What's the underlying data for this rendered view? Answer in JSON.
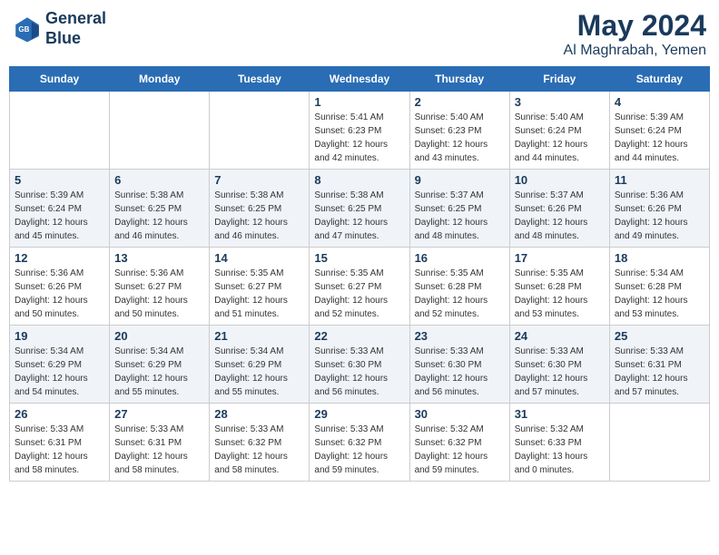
{
  "header": {
    "logo_line1": "General",
    "logo_line2": "Blue",
    "title": "May 2024",
    "subtitle": "Al Maghrabah, Yemen"
  },
  "days_of_week": [
    "Sunday",
    "Monday",
    "Tuesday",
    "Wednesday",
    "Thursday",
    "Friday",
    "Saturday"
  ],
  "weeks": [
    [
      {
        "day": "",
        "sunrise": "",
        "sunset": "",
        "daylight": ""
      },
      {
        "day": "",
        "sunrise": "",
        "sunset": "",
        "daylight": ""
      },
      {
        "day": "",
        "sunrise": "",
        "sunset": "",
        "daylight": ""
      },
      {
        "day": "1",
        "sunrise": "5:41 AM",
        "sunset": "6:23 PM",
        "daylight": "12 hours and 42 minutes."
      },
      {
        "day": "2",
        "sunrise": "5:40 AM",
        "sunset": "6:23 PM",
        "daylight": "12 hours and 43 minutes."
      },
      {
        "day": "3",
        "sunrise": "5:40 AM",
        "sunset": "6:24 PM",
        "daylight": "12 hours and 44 minutes."
      },
      {
        "day": "4",
        "sunrise": "5:39 AM",
        "sunset": "6:24 PM",
        "daylight": "12 hours and 44 minutes."
      }
    ],
    [
      {
        "day": "5",
        "sunrise": "5:39 AM",
        "sunset": "6:24 PM",
        "daylight": "12 hours and 45 minutes."
      },
      {
        "day": "6",
        "sunrise": "5:38 AM",
        "sunset": "6:25 PM",
        "daylight": "12 hours and 46 minutes."
      },
      {
        "day": "7",
        "sunrise": "5:38 AM",
        "sunset": "6:25 PM",
        "daylight": "12 hours and 46 minutes."
      },
      {
        "day": "8",
        "sunrise": "5:38 AM",
        "sunset": "6:25 PM",
        "daylight": "12 hours and 47 minutes."
      },
      {
        "day": "9",
        "sunrise": "5:37 AM",
        "sunset": "6:25 PM",
        "daylight": "12 hours and 48 minutes."
      },
      {
        "day": "10",
        "sunrise": "5:37 AM",
        "sunset": "6:26 PM",
        "daylight": "12 hours and 48 minutes."
      },
      {
        "day": "11",
        "sunrise": "5:36 AM",
        "sunset": "6:26 PM",
        "daylight": "12 hours and 49 minutes."
      }
    ],
    [
      {
        "day": "12",
        "sunrise": "5:36 AM",
        "sunset": "6:26 PM",
        "daylight": "12 hours and 50 minutes."
      },
      {
        "day": "13",
        "sunrise": "5:36 AM",
        "sunset": "6:27 PM",
        "daylight": "12 hours and 50 minutes."
      },
      {
        "day": "14",
        "sunrise": "5:35 AM",
        "sunset": "6:27 PM",
        "daylight": "12 hours and 51 minutes."
      },
      {
        "day": "15",
        "sunrise": "5:35 AM",
        "sunset": "6:27 PM",
        "daylight": "12 hours and 52 minutes."
      },
      {
        "day": "16",
        "sunrise": "5:35 AM",
        "sunset": "6:28 PM",
        "daylight": "12 hours and 52 minutes."
      },
      {
        "day": "17",
        "sunrise": "5:35 AM",
        "sunset": "6:28 PM",
        "daylight": "12 hours and 53 minutes."
      },
      {
        "day": "18",
        "sunrise": "5:34 AM",
        "sunset": "6:28 PM",
        "daylight": "12 hours and 53 minutes."
      }
    ],
    [
      {
        "day": "19",
        "sunrise": "5:34 AM",
        "sunset": "6:29 PM",
        "daylight": "12 hours and 54 minutes."
      },
      {
        "day": "20",
        "sunrise": "5:34 AM",
        "sunset": "6:29 PM",
        "daylight": "12 hours and 55 minutes."
      },
      {
        "day": "21",
        "sunrise": "5:34 AM",
        "sunset": "6:29 PM",
        "daylight": "12 hours and 55 minutes."
      },
      {
        "day": "22",
        "sunrise": "5:33 AM",
        "sunset": "6:30 PM",
        "daylight": "12 hours and 56 minutes."
      },
      {
        "day": "23",
        "sunrise": "5:33 AM",
        "sunset": "6:30 PM",
        "daylight": "12 hours and 56 minutes."
      },
      {
        "day": "24",
        "sunrise": "5:33 AM",
        "sunset": "6:30 PM",
        "daylight": "12 hours and 57 minutes."
      },
      {
        "day": "25",
        "sunrise": "5:33 AM",
        "sunset": "6:31 PM",
        "daylight": "12 hours and 57 minutes."
      }
    ],
    [
      {
        "day": "26",
        "sunrise": "5:33 AM",
        "sunset": "6:31 PM",
        "daylight": "12 hours and 58 minutes."
      },
      {
        "day": "27",
        "sunrise": "5:33 AM",
        "sunset": "6:31 PM",
        "daylight": "12 hours and 58 minutes."
      },
      {
        "day": "28",
        "sunrise": "5:33 AM",
        "sunset": "6:32 PM",
        "daylight": "12 hours and 58 minutes."
      },
      {
        "day": "29",
        "sunrise": "5:33 AM",
        "sunset": "6:32 PM",
        "daylight": "12 hours and 59 minutes."
      },
      {
        "day": "30",
        "sunrise": "5:32 AM",
        "sunset": "6:32 PM",
        "daylight": "12 hours and 59 minutes."
      },
      {
        "day": "31",
        "sunrise": "5:32 AM",
        "sunset": "6:33 PM",
        "daylight": "13 hours and 0 minutes."
      },
      {
        "day": "",
        "sunrise": "",
        "sunset": "",
        "daylight": ""
      }
    ]
  ]
}
